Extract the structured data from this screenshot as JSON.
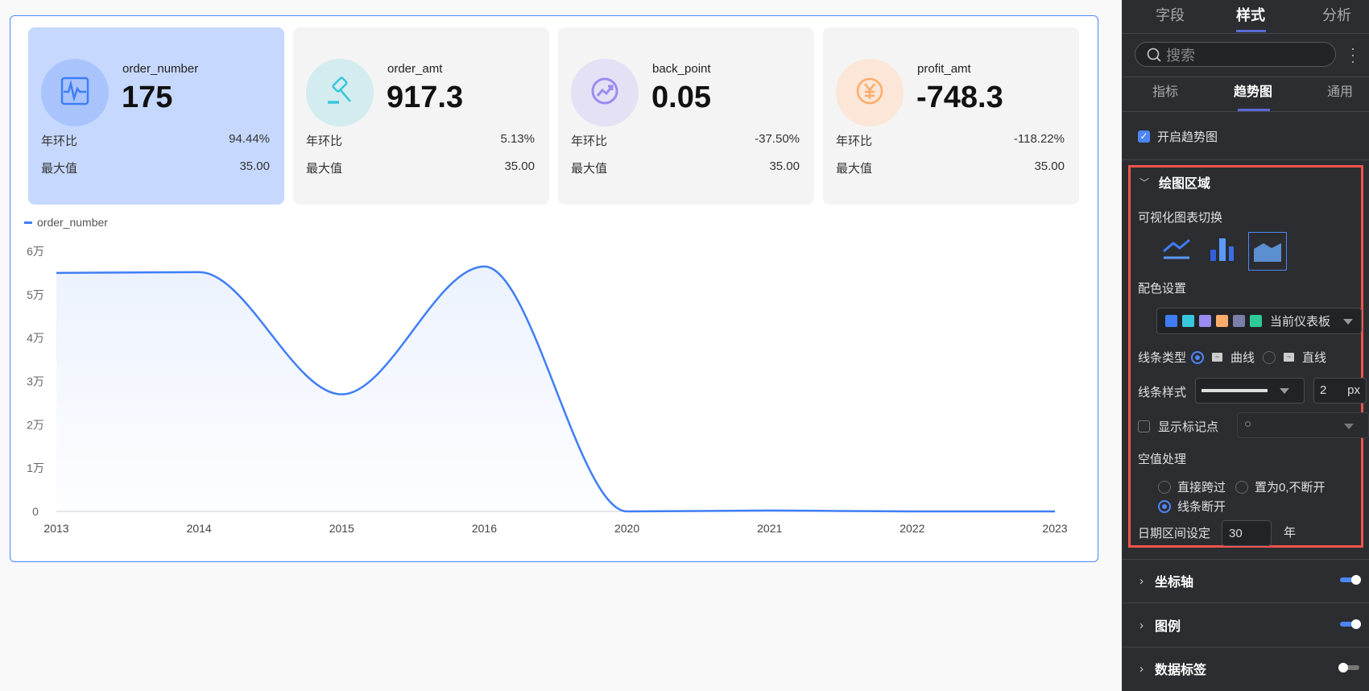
{
  "cards": [
    {
      "name": "order_number",
      "value": "175",
      "yoy_label": "年环比",
      "yoy": "94.44%",
      "max_label": "最大值",
      "max": "35.00",
      "icon": "pulse-icon",
      "color": "#3f7ef6",
      "bg": "#a9c4fd",
      "active": true
    },
    {
      "name": "order_amt",
      "value": "917.3",
      "yoy_label": "年环比",
      "yoy": "5.13%",
      "max_label": "最大值",
      "max": "35.00",
      "icon": "gavel-icon",
      "color": "#36c7dc",
      "bg": "#d3ecf0",
      "active": false
    },
    {
      "name": "back_point",
      "value": "0.05",
      "yoy_label": "年环比",
      "yoy": "-37.50%",
      "max_label": "最大值",
      "max": "35.00",
      "icon": "trend-up-icon",
      "color": "#9a8cf0",
      "bg": "#e4e1f5",
      "active": false
    },
    {
      "name": "profit_amt",
      "value": "-748.3",
      "yoy_label": "年环比",
      "yoy": "-118.22%",
      "max_label": "最大值",
      "max": "35.00",
      "icon": "yen-icon",
      "color": "#fbac6a",
      "bg": "#fbe6d8",
      "active": false
    }
  ],
  "chart_data": {
    "type": "area",
    "legend": [
      "order_number"
    ],
    "legend_position": "top-left",
    "categories": [
      "2013",
      "2014",
      "2015",
      "2016",
      "2020",
      "2021",
      "2022",
      "2023"
    ],
    "series": [
      {
        "name": "order_number",
        "values": [
          55000,
          55200,
          27000,
          56500,
          0,
          200,
          0,
          0
        ],
        "color": "#3f7ef6"
      }
    ],
    "y_ticks": [
      {
        "v": 0,
        "label": "0"
      },
      {
        "v": 10000,
        "label": "1万"
      },
      {
        "v": 20000,
        "label": "2万"
      },
      {
        "v": 30000,
        "label": "3万"
      },
      {
        "v": 40000,
        "label": "4万"
      },
      {
        "v": 50000,
        "label": "5万"
      },
      {
        "v": 60000,
        "label": "6万"
      }
    ],
    "ylim": [
      0,
      60000
    ],
    "grid": false,
    "smooth": true
  },
  "panel": {
    "tabs": [
      "字段",
      "样式",
      "分析"
    ],
    "search_placeholder": "搜索",
    "subtabs": [
      "指标",
      "趋势图",
      "通用"
    ],
    "enable_trend": "开启趋势图",
    "section_title": "绘图区域",
    "chart_switch_label": "可视化图表切换",
    "color_label": "配色设置",
    "palette": [
      "#3f7ef6",
      "#36c7dc",
      "#9a8cf0",
      "#fbac6a",
      "#7a7fa8",
      "#2fcb97"
    ],
    "palette_name": "当前仪表板",
    "line_type_label": "线条类型",
    "curve": "曲线",
    "straight": "直线",
    "line_style_label": "线条样式",
    "line_width": "2",
    "px": "px",
    "show_markers": "显示标记点",
    "marker_symbol": "○",
    "null_label": "空值处理",
    "null_opts": [
      "直接跨过",
      "置为0,不断开",
      "线条断开"
    ],
    "date_range_label": "日期区间设定",
    "date_range": "30",
    "year_unit": "年",
    "sections": [
      {
        "title": "坐标轴",
        "on": true
      },
      {
        "title": "图例",
        "on": true
      },
      {
        "title": "数据标签",
        "on": false
      }
    ]
  }
}
